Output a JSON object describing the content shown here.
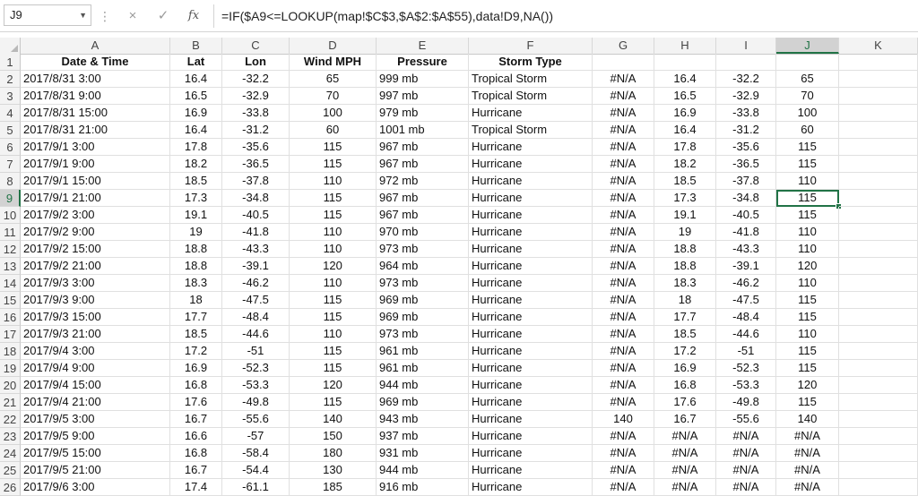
{
  "formula_bar": {
    "name_box": "J9",
    "cancel_icon": "×",
    "enter_icon": "✓",
    "fx_label": "fx",
    "formula": "=IF($A9<=LOOKUP(map!$C$3,$A$2:$A$55),data!D9,NA())"
  },
  "columns": [
    "A",
    "B",
    "C",
    "D",
    "E",
    "F",
    "G",
    "H",
    "I",
    "J",
    "K"
  ],
  "selected_cell": {
    "col": "J",
    "row": "9"
  },
  "rows": [
    {
      "n": "1",
      "cells": [
        "Date & Time",
        "Lat",
        "Lon",
        "Wind MPH",
        "Pressure",
        "Storm Type",
        "",
        "",
        "",
        "",
        ""
      ]
    },
    {
      "n": "2",
      "cells": [
        "2017/8/31 3:00",
        "16.4",
        "-32.2",
        "65",
        "999 mb",
        "Tropical Storm",
        "#N/A",
        "16.4",
        "-32.2",
        "65",
        ""
      ]
    },
    {
      "n": "3",
      "cells": [
        "2017/8/31 9:00",
        "16.5",
        "-32.9",
        "70",
        "997 mb",
        "Tropical Storm",
        "#N/A",
        "16.5",
        "-32.9",
        "70",
        ""
      ]
    },
    {
      "n": "4",
      "cells": [
        "2017/8/31 15:00",
        "16.9",
        "-33.8",
        "100",
        "979 mb",
        "Hurricane",
        "#N/A",
        "16.9",
        "-33.8",
        "100",
        ""
      ]
    },
    {
      "n": "5",
      "cells": [
        "2017/8/31 21:00",
        "16.4",
        "-31.2",
        "60",
        "1001 mb",
        "Tropical Storm",
        "#N/A",
        "16.4",
        "-31.2",
        "60",
        ""
      ]
    },
    {
      "n": "6",
      "cells": [
        "2017/9/1 3:00",
        "17.8",
        "-35.6",
        "115",
        "967 mb",
        "Hurricane",
        "#N/A",
        "17.8",
        "-35.6",
        "115",
        ""
      ]
    },
    {
      "n": "7",
      "cells": [
        "2017/9/1 9:00",
        "18.2",
        "-36.5",
        "115",
        "967 mb",
        "Hurricane",
        "#N/A",
        "18.2",
        "-36.5",
        "115",
        ""
      ]
    },
    {
      "n": "8",
      "cells": [
        "2017/9/1 15:00",
        "18.5",
        "-37.8",
        "110",
        "972 mb",
        "Hurricane",
        "#N/A",
        "18.5",
        "-37.8",
        "110",
        ""
      ]
    },
    {
      "n": "9",
      "cells": [
        "2017/9/1 21:00",
        "17.3",
        "-34.8",
        "115",
        "967 mb",
        "Hurricane",
        "#N/A",
        "17.3",
        "-34.8",
        "115",
        ""
      ]
    },
    {
      "n": "10",
      "cells": [
        "2017/9/2 3:00",
        "19.1",
        "-40.5",
        "115",
        "967 mb",
        "Hurricane",
        "#N/A",
        "19.1",
        "-40.5",
        "115",
        ""
      ]
    },
    {
      "n": "11",
      "cells": [
        "2017/9/2 9:00",
        "19",
        "-41.8",
        "110",
        "970 mb",
        "Hurricane",
        "#N/A",
        "19",
        "-41.8",
        "110",
        ""
      ]
    },
    {
      "n": "12",
      "cells": [
        "2017/9/2 15:00",
        "18.8",
        "-43.3",
        "110",
        "973 mb",
        "Hurricane",
        "#N/A",
        "18.8",
        "-43.3",
        "110",
        ""
      ]
    },
    {
      "n": "13",
      "cells": [
        "2017/9/2 21:00",
        "18.8",
        "-39.1",
        "120",
        "964 mb",
        "Hurricane",
        "#N/A",
        "18.8",
        "-39.1",
        "120",
        ""
      ]
    },
    {
      "n": "14",
      "cells": [
        "2017/9/3 3:00",
        "18.3",
        "-46.2",
        "110",
        "973 mb",
        "Hurricane",
        "#N/A",
        "18.3",
        "-46.2",
        "110",
        ""
      ]
    },
    {
      "n": "15",
      "cells": [
        "2017/9/3 9:00",
        "18",
        "-47.5",
        "115",
        "969 mb",
        "Hurricane",
        "#N/A",
        "18",
        "-47.5",
        "115",
        ""
      ]
    },
    {
      "n": "16",
      "cells": [
        "2017/9/3 15:00",
        "17.7",
        "-48.4",
        "115",
        "969 mb",
        "Hurricane",
        "#N/A",
        "17.7",
        "-48.4",
        "115",
        ""
      ]
    },
    {
      "n": "17",
      "cells": [
        "2017/9/3 21:00",
        "18.5",
        "-44.6",
        "110",
        "973 mb",
        "Hurricane",
        "#N/A",
        "18.5",
        "-44.6",
        "110",
        ""
      ]
    },
    {
      "n": "18",
      "cells": [
        "2017/9/4 3:00",
        "17.2",
        "-51",
        "115",
        "961 mb",
        "Hurricane",
        "#N/A",
        "17.2",
        "-51",
        "115",
        ""
      ]
    },
    {
      "n": "19",
      "cells": [
        "2017/9/4 9:00",
        "16.9",
        "-52.3",
        "115",
        "961 mb",
        "Hurricane",
        "#N/A",
        "16.9",
        "-52.3",
        "115",
        ""
      ]
    },
    {
      "n": "20",
      "cells": [
        "2017/9/4 15:00",
        "16.8",
        "-53.3",
        "120",
        "944 mb",
        "Hurricane",
        "#N/A",
        "16.8",
        "-53.3",
        "120",
        ""
      ]
    },
    {
      "n": "21",
      "cells": [
        "2017/9/4 21:00",
        "17.6",
        "-49.8",
        "115",
        "969 mb",
        "Hurricane",
        "#N/A",
        "17.6",
        "-49.8",
        "115",
        ""
      ]
    },
    {
      "n": "22",
      "cells": [
        "2017/9/5 3:00",
        "16.7",
        "-55.6",
        "140",
        "943 mb",
        "Hurricane",
        "140",
        "16.7",
        "-55.6",
        "140",
        ""
      ]
    },
    {
      "n": "23",
      "cells": [
        "2017/9/5 9:00",
        "16.6",
        "-57",
        "150",
        "937 mb",
        "Hurricane",
        "#N/A",
        "#N/A",
        "#N/A",
        "#N/A",
        ""
      ]
    },
    {
      "n": "24",
      "cells": [
        "2017/9/5 15:00",
        "16.8",
        "-58.4",
        "180",
        "931 mb",
        "Hurricane",
        "#N/A",
        "#N/A",
        "#N/A",
        "#N/A",
        ""
      ]
    },
    {
      "n": "25",
      "cells": [
        "2017/9/5 21:00",
        "16.7",
        "-54.4",
        "130",
        "944 mb",
        "Hurricane",
        "#N/A",
        "#N/A",
        "#N/A",
        "#N/A",
        ""
      ]
    },
    {
      "n": "26",
      "cells": [
        "2017/9/6 3:00",
        "17.4",
        "-61.1",
        "185",
        "916 mb",
        "Hurricane",
        "#N/A",
        "#N/A",
        "#N/A",
        "#N/A",
        ""
      ]
    }
  ]
}
